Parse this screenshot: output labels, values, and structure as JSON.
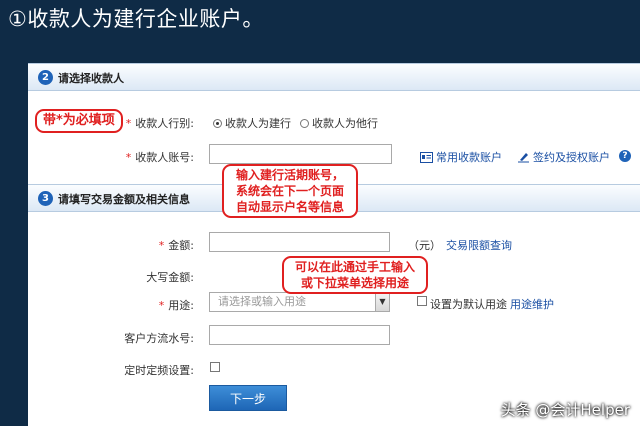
{
  "slide_title": "①收款人为建行企业账户。",
  "section1": {
    "number": "2",
    "title": "请选择收款人"
  },
  "section2": {
    "number": "3",
    "title": "请填写交易金额及相关信息"
  },
  "form": {
    "payee_bank_label": "收款人行别:",
    "radio_ccb": "收款人为建行",
    "radio_other": "收款人为他行",
    "payee_account_label": "收款人账号:",
    "frequent_accounts_link": "常用收款账户",
    "sign_authorize_link": "签约及授权账户",
    "help_glyph": "?",
    "amount_label": "金额:",
    "amount_unit": "（元）",
    "limit_query_link": "交易限额查询",
    "amount_caps_label": "大写金额:",
    "purpose_label": "用途:",
    "purpose_placeholder": "请选择或输入用途",
    "set_default_label": "设置为默认用途",
    "purpose_maintain_link": "用途维护",
    "customer_serial_label": "客户方流水号:",
    "scheduled_label": "定时定频设置:",
    "next_button": "下一步",
    "required_star": "*"
  },
  "callouts": {
    "required_note": "带*为必填项",
    "account_note": [
      "输入建行活期账号，",
      "系统会在下一个页面",
      "自动显示户名等信息"
    ],
    "purpose_note": [
      "可以在此通过手工输入",
      "或下拉菜单选择用途"
    ]
  },
  "watermark": "头条 @会计Helper",
  "colors": {
    "background": "#0f2b46",
    "accent": "#1f63b8",
    "callout": "#e02020"
  },
  "state": {
    "payee_type_selected": "收款人为建行",
    "set_default_checked": false,
    "scheduled_checked": false
  }
}
